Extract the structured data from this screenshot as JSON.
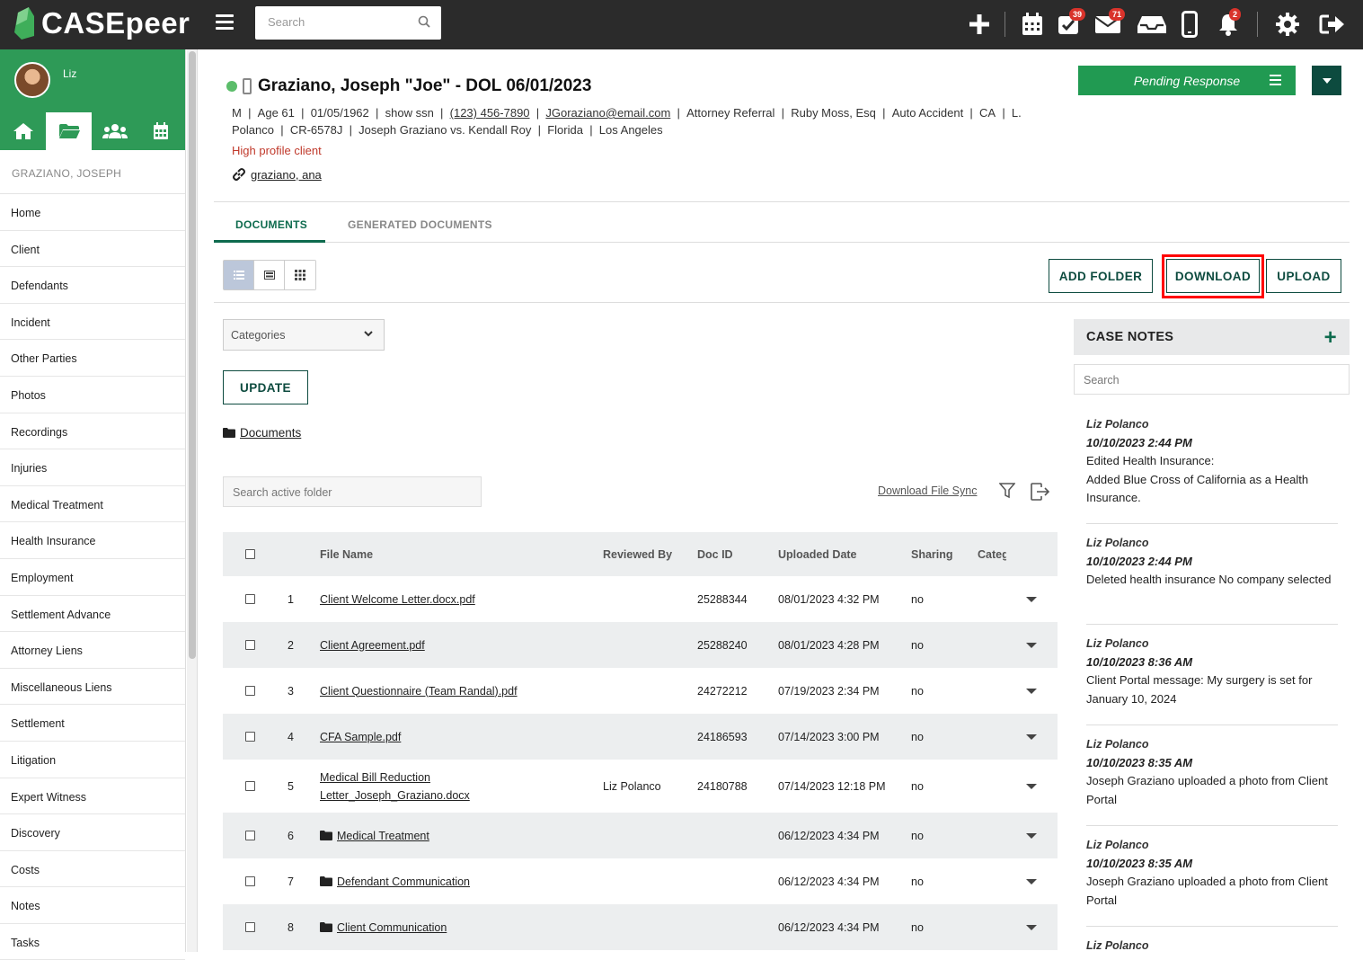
{
  "app": {
    "logo_text": "CASEpeer"
  },
  "topbar": {
    "search_placeholder": "Search",
    "badges": {
      "tasks": "39",
      "mail": "71",
      "notifications": "2"
    }
  },
  "sidebar": {
    "user": "Liz",
    "case_name": "GRAZIANO, JOSEPH",
    "items": [
      "Home",
      "Client",
      "Defendants",
      "Incident",
      "Other Parties",
      "Photos",
      "Recordings",
      "Injuries",
      "Medical Treatment",
      "Health Insurance",
      "Employment",
      "Settlement Advance",
      "Attorney Liens",
      "Miscellaneous Liens",
      "Settlement",
      "Litigation",
      "Expert Witness",
      "Discovery",
      "Costs",
      "Notes",
      "Tasks"
    ]
  },
  "case": {
    "title": "Graziano, Joseph \"Joe\" - DOL 06/01/2023",
    "info_line1": [
      "M",
      "Age 61",
      "01/05/1962",
      "show ssn",
      "(123) 456-7890",
      "JGoraziano@email.com",
      "Attorney Referral",
      "Ruby Moss, Esq",
      "Auto Accident",
      "CA",
      "L."
    ],
    "info_line2": [
      "Polanco",
      "CR-6578J",
      "Joseph Graziano vs. Kendall Roy",
      "Florida",
      "Los Angeles"
    ],
    "high_profile": "High profile client",
    "related_link": "graziano, ana",
    "status": "Pending Response"
  },
  "tabs": {
    "documents": "DOCUMENTS",
    "generated": "GENERATED DOCUMENTS"
  },
  "toolbar": {
    "add_folder": "ADD FOLDER",
    "download": "DOWNLOAD",
    "upload": "UPLOAD"
  },
  "filters": {
    "categories": "Categories",
    "update": "UPDATE",
    "breadcrumb": "Documents",
    "folder_search_placeholder": "Search active folder",
    "download_file_sync": "Download File Sync"
  },
  "table": {
    "headers": {
      "file_name": "File Name",
      "reviewed_by": "Reviewed By",
      "doc_id": "Doc ID",
      "uploaded": "Uploaded Date",
      "sharing": "Sharing",
      "category": "Categ"
    },
    "rows": [
      {
        "num": "1",
        "name": "Client Welcome Letter.docx.pdf",
        "name2": "",
        "folder": false,
        "reviewed": "",
        "doc_id": "25288344",
        "date": "08/01/2023 4:32 PM",
        "sharing": "no"
      },
      {
        "num": "2",
        "name": "Client Agreement.pdf",
        "name2": "",
        "folder": false,
        "reviewed": "",
        "doc_id": "25288240",
        "date": "08/01/2023 4:28 PM",
        "sharing": "no"
      },
      {
        "num": "3",
        "name": "Client Questionnaire (Team Randal).pdf",
        "name2": "",
        "folder": false,
        "reviewed": "",
        "doc_id": "24272212",
        "date": "07/19/2023 2:34 PM",
        "sharing": "no"
      },
      {
        "num": "4",
        "name": "CFA Sample.pdf",
        "name2": "",
        "folder": false,
        "reviewed": "",
        "doc_id": "24186593",
        "date": "07/14/2023 3:00 PM",
        "sharing": "no"
      },
      {
        "num": "5",
        "name": "Medical Bill Reduction",
        "name2": "Letter_Joseph_Graziano.docx",
        "folder": false,
        "reviewed": "Liz Polanco",
        "doc_id": "24180788",
        "date": "07/14/2023 12:18 PM",
        "sharing": "no"
      },
      {
        "num": "6",
        "name": "Medical Treatment",
        "name2": "",
        "folder": true,
        "reviewed": "",
        "doc_id": "",
        "date": "06/12/2023 4:34 PM",
        "sharing": "no"
      },
      {
        "num": "7",
        "name": "Defendant Communication",
        "name2": "",
        "folder": true,
        "reviewed": "",
        "doc_id": "",
        "date": "06/12/2023 4:34 PM",
        "sharing": "no"
      },
      {
        "num": "8",
        "name": "Client Communication",
        "name2": "",
        "folder": true,
        "reviewed": "",
        "doc_id": "",
        "date": "06/12/2023 4:34 PM",
        "sharing": "no"
      }
    ]
  },
  "notes": {
    "title": "CASE NOTES",
    "search_placeholder": "Search",
    "items": [
      {
        "author": "Liz Polanco",
        "date": "10/10/2023 2:44 PM",
        "lines": [
          "Edited Health Insurance:",
          "Added Blue Cross of California as a Health Insurance."
        ]
      },
      {
        "author": "Liz Polanco",
        "date": "10/10/2023 2:44 PM",
        "lines": [
          "Deleted health insurance No company selected"
        ]
      },
      {
        "author": "Liz Polanco",
        "date": "10/10/2023 8:36 AM",
        "lines": [
          "Client Portal message: My surgery is set for January 10, 2024"
        ]
      },
      {
        "author": "Liz Polanco",
        "date": "10/10/2023 8:35 AM",
        "lines": [
          "Joseph Graziano uploaded a photo from Client Portal"
        ]
      },
      {
        "author": "Liz Polanco",
        "date": "10/10/2023 8:35 AM",
        "lines": [
          "Joseph Graziano uploaded a photo from Client Portal"
        ]
      },
      {
        "author": "Liz Polanco",
        "date": "",
        "lines": []
      }
    ]
  }
}
